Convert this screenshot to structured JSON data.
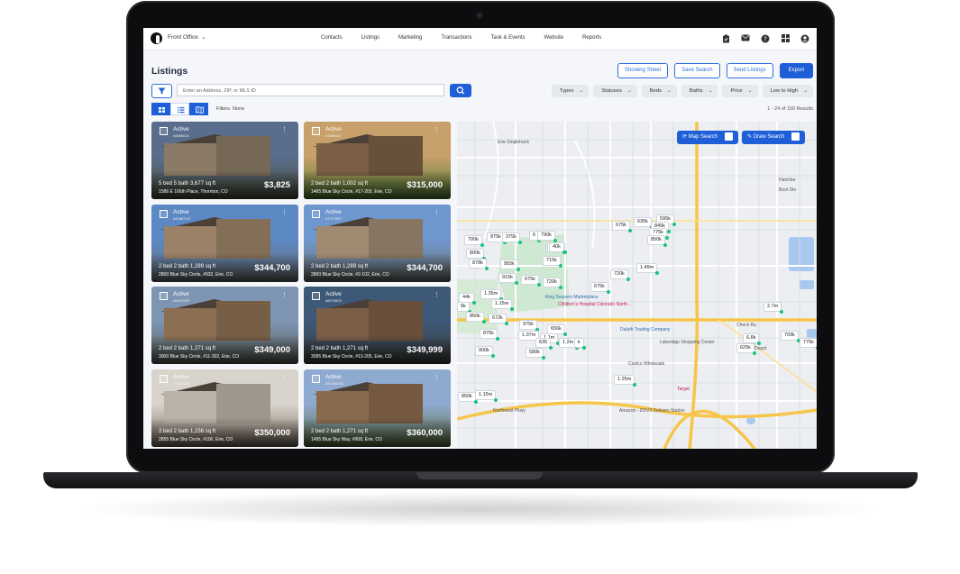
{
  "app": {
    "office": "Front Office",
    "nav": [
      "Contacts",
      "Listings",
      "Marketing",
      "Transactions",
      "Task & Events",
      "Website",
      "Reports"
    ],
    "nav_icons": [
      "clipboard-check-icon",
      "mail-icon",
      "help-icon",
      "apps-grid-icon",
      "user-icon"
    ]
  },
  "page": {
    "title": "Listings",
    "buttons": {
      "showing": "Showing Sheet",
      "save": "Save Search",
      "send": "Send Listings",
      "export": "Export"
    },
    "search_placeholder": "Enter an Address, ZIP, or MLS ID",
    "dropdowns": [
      "Types",
      "Statuses",
      "Beds",
      "Baths",
      "Price",
      "Low to High"
    ],
    "filters_label": "Filters",
    "filters_value": "None",
    "result_count": "1 - 24 of 150 Results"
  },
  "listings": [
    {
      "status": "Active",
      "mls": "#4686010",
      "beds": "5 bed  5 bath  3,677 sq ft",
      "address": "1586 E 166th Place, Thornton, CO",
      "price": "$3,825",
      "sky": "#5a6d8c",
      "ground": "#4b4f3a",
      "body": "#8a7a66"
    },
    {
      "status": "Active",
      "mls": "#3589417",
      "beds": "2 bed  2 bath  1,002 sq ft",
      "address": "1465 Blue Sky Circle, #17-205, Erie, CO",
      "price": "$315,000",
      "sky": "#c7a06b",
      "ground": "#4f7d36",
      "body": "#7a5f44"
    },
    {
      "status": "Active",
      "mls": "#91887147",
      "beds": "2 bed  2 bath  1,289 sq ft",
      "address": "2800 Blue Sky Circle, #932, Erie, CO",
      "price": "$344,700",
      "sky": "#5c88c4",
      "ground": "#6a6f73",
      "body": "#9a8168"
    },
    {
      "status": "Active",
      "mls": "#1717857",
      "beds": "2 bed  2 bath  1,289 sq ft",
      "address": "2800 Blue Sky Circle, #2-102, Erie, CO",
      "price": "$344,700",
      "sky": "#6f97cf",
      "ground": "#6b7068",
      "body": "#a08a72"
    },
    {
      "status": "Active",
      "mls": "#5047093",
      "beds": "2 bed  2 bath  1,271 sq ft",
      "address": "3000 Blue Sky Circle, #11-302, Erie, CO",
      "price": "$349,000",
      "sky": "#7d95b3",
      "ground": "#5b5f55",
      "body": "#8c6e52"
    },
    {
      "status": "Active",
      "mls": "#6076503",
      "beds": "2 bed  2 bath  1,271 sq ft",
      "address": "3095 Blue Sky Circle, #13-205, Erie, CO",
      "price": "$349,999",
      "sky": "#3e5878",
      "ground": "#3f3f3a",
      "body": "#7a5e47"
    },
    {
      "status": "Active",
      "mls": "#2324988",
      "beds": "2 bed  2 bath  1,156 sq ft",
      "address": "2855 Blue Sky Circle, #106, Erie, CO",
      "price": "$350,000",
      "sky": "#d8d4cc",
      "ground": "#7a6c5e",
      "body": "#b9b2a6"
    },
    {
      "status": "Active",
      "mls": "#91006230",
      "beds": "2 bed  2 bath  1,271 sq ft",
      "address": "1495 Blue Sky Way, #908, Erie, CO",
      "price": "$360,000",
      "sky": "#8faad0",
      "ground": "#5a6b3c",
      "body": "#8a6a4c"
    }
  ],
  "map": {
    "map_search": "Map Search",
    "draw_search": "Draw Search",
    "pins": [
      "700k",
      "875k",
      "375k",
      "6",
      "790k",
      "800k",
      "940k",
      "40k",
      "675k",
      "635k",
      "595k",
      "845k",
      "775k",
      "850k",
      "878k",
      "955k",
      "715k",
      "1.49m",
      "720k",
      "915k",
      "675k",
      "720k",
      "675k",
      "44k",
      "1.35m",
      "5k",
      "1.15m",
      "850k",
      "672k",
      "975k",
      "656k",
      "875k",
      "1.07m",
      "1.1m",
      "635",
      "1.2m",
      "k",
      "900k",
      "580k",
      "6.8k",
      "625k",
      "709k",
      "775k",
      "2.7m",
      "1.25m",
      "850k",
      "1.15m"
    ],
    "labels": [
      "Erie Singletrack",
      "Children's Hospital Colorado North...",
      "King Soopers Marketplace",
      "Duluth Trading Company",
      "Lakeridge Shopping Center",
      "Costco Wholesale",
      "Amazon - DDV3 Delivery Station",
      "Check Ru",
      "Depot",
      "Hatchbe",
      "Boot Sto",
      "Target",
      "Northwest Pkwy"
    ]
  }
}
